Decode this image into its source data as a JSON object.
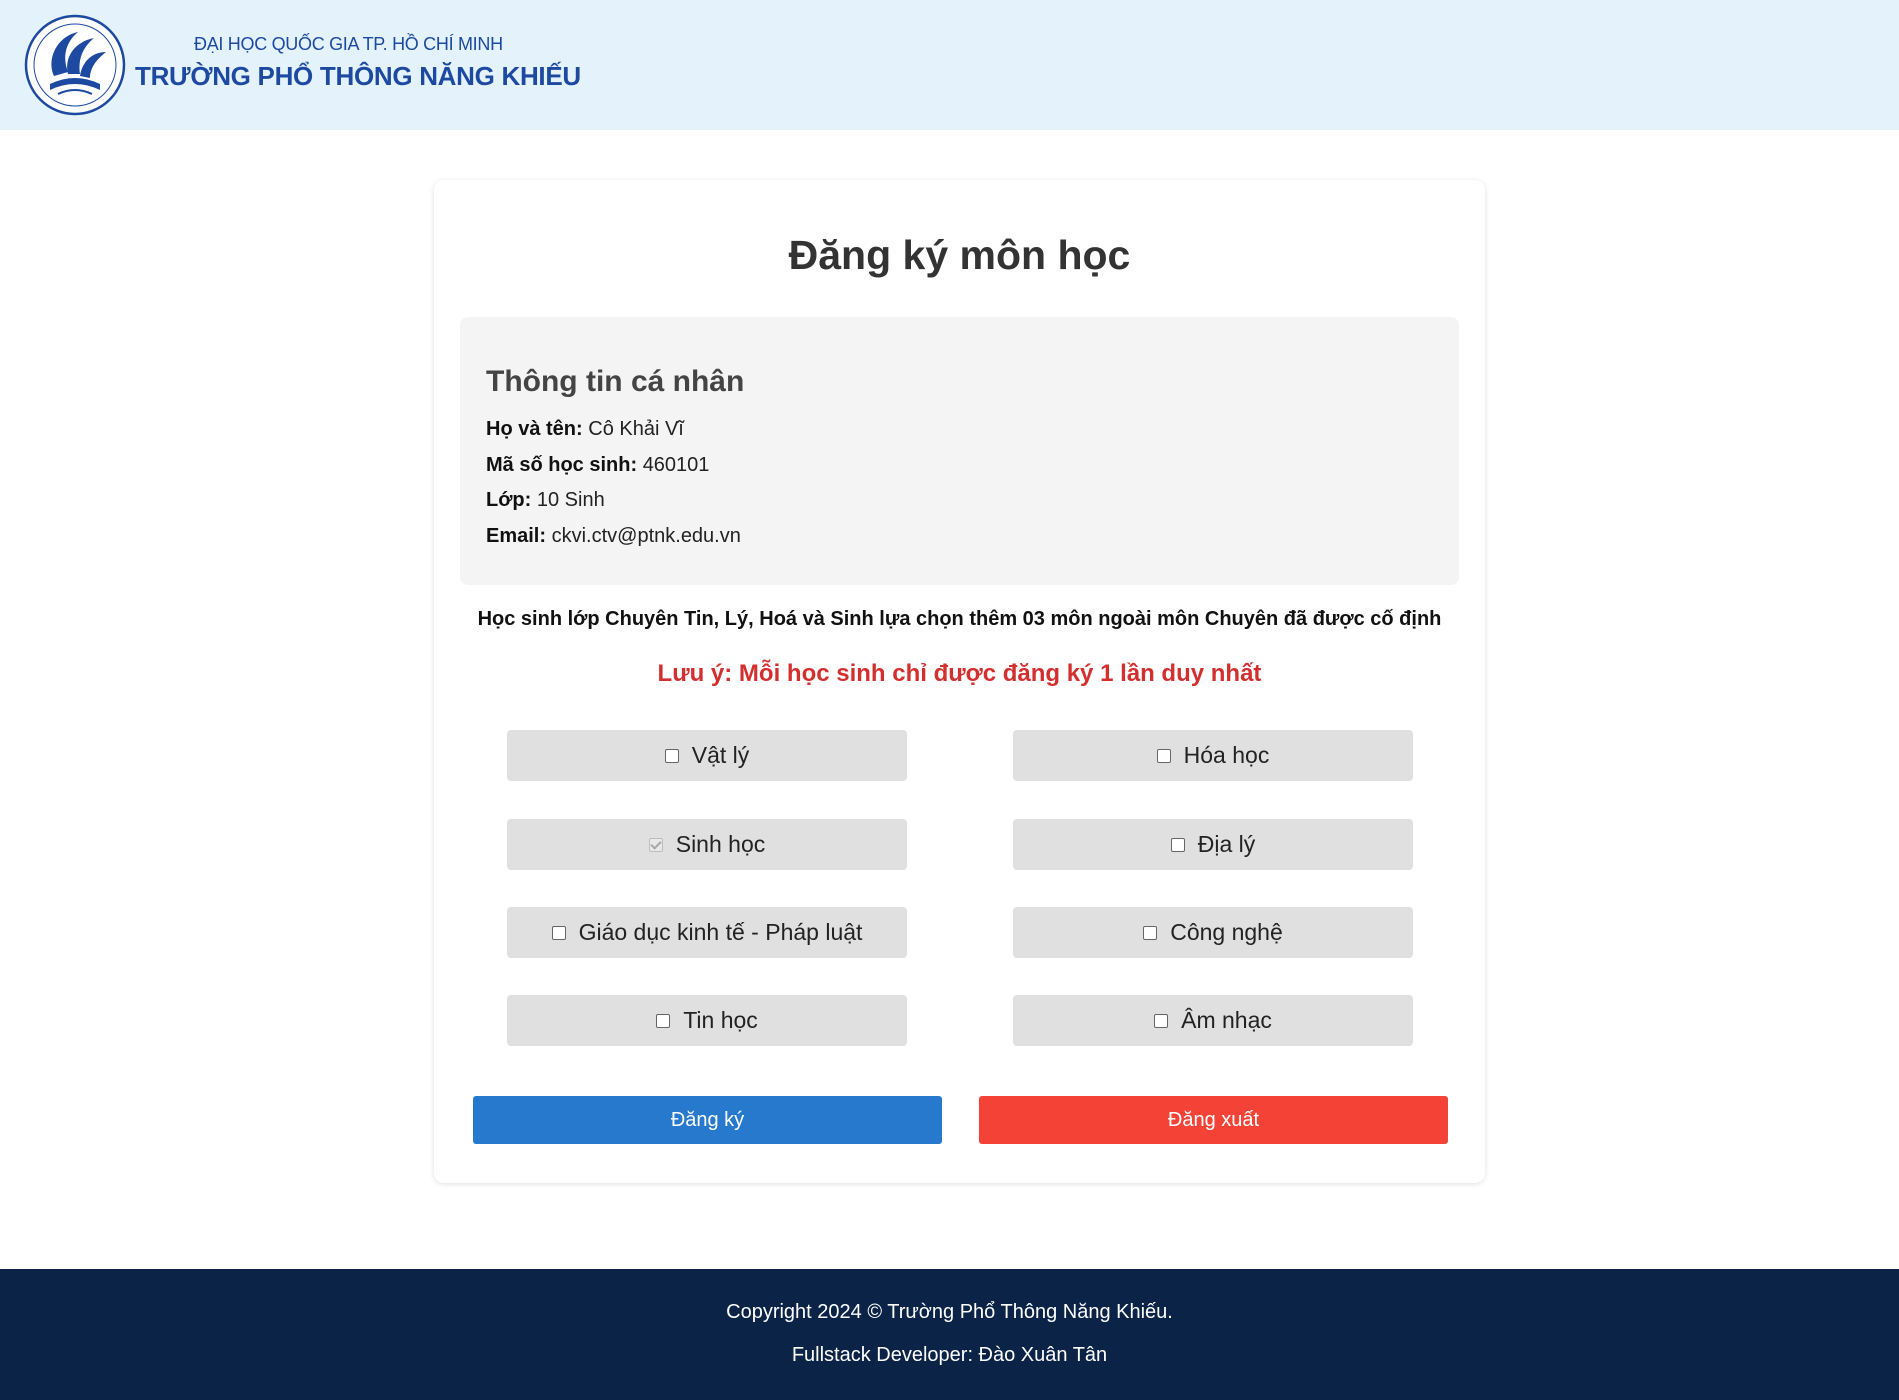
{
  "header": {
    "logo_line1": "ĐẠI HỌC QUỐC GIA TP. HỒ CHÍ MINH",
    "logo_line2": "TRƯỜNG PHỔ THÔNG NĂNG KHIẾU",
    "brand_color": "#1d4aa0"
  },
  "card": {
    "title": "Đăng ký môn học"
  },
  "info": {
    "title": "Thông tin cá nhân",
    "name_label": "Họ và tên:",
    "name_value": "Cô Khải Vĩ",
    "id_label": "Mã số học sinh:",
    "id_value": "460101",
    "class_label": "Lớp:",
    "class_value": "10 Sinh",
    "email_label": "Email:",
    "email_value": "ckvi.ctv@ptnk.edu.vn"
  },
  "notes": {
    "instruction": "Học sinh lớp Chuyên Tin, Lý, Hoá và Sinh lựa chọn thêm 03 môn ngoài môn Chuyên đã được cố định",
    "warning": "Lưu ý: Mỗi học sinh chỉ được đăng ký 1 lần duy nhất",
    "warning_color": "#d32f2f"
  },
  "subjects": [
    {
      "label": "Vật lý",
      "checked": false
    },
    {
      "label": "Hóa học",
      "checked": false
    },
    {
      "label": "Sinh học",
      "checked": true
    },
    {
      "label": "Địa lý",
      "checked": false
    },
    {
      "label": "Giáo dục kinh tế - Pháp luật",
      "checked": false
    },
    {
      "label": "Công nghệ",
      "checked": false
    },
    {
      "label": "Tin học",
      "checked": false
    },
    {
      "label": "Âm nhạc",
      "checked": false
    }
  ],
  "buttons": {
    "register": "Đăng ký",
    "logout": "Đăng xuất",
    "register_color": "#2779cd",
    "logout_color": "#f44336"
  },
  "footer": {
    "copyright": "Copyright 2024 © Trường Phổ Thông Năng Khiếu.",
    "developer": "Fullstack Developer: Đào Xuân Tân",
    "bg_color": "#0a2347"
  }
}
